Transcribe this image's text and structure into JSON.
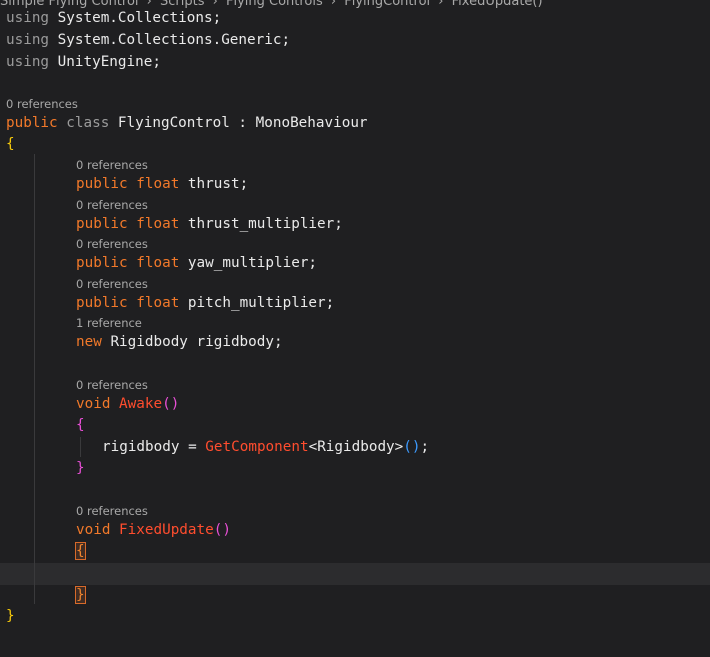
{
  "breadcrumb": {
    "items": [
      "Simple Flying Control",
      "Scripts",
      "Flying Controls",
      "FlyingControl",
      "FixedUpdate()"
    ],
    "separator": "›"
  },
  "code": {
    "using1_kw": "using",
    "using1_ns": "System.Collections;",
    "using2_kw": "using",
    "using2_ns": "System.Collections.Generic;",
    "using3_kw": "using",
    "using3_ns": "UnityEngine;",
    "class_refs": "0 references",
    "class_public": "public",
    "class_kw": "class",
    "class_name": "FlyingControl : MonoBehaviour",
    "class_open": "{",
    "fields": [
      {
        "refs": "0 references",
        "mod": "public",
        "type": "float",
        "name": "thrust;"
      },
      {
        "refs": "0 references",
        "mod": "public",
        "type": "float",
        "name": "thrust_multiplier;"
      },
      {
        "refs": "0 references",
        "mod": "public",
        "type": "float",
        "name": "yaw_multiplier;"
      },
      {
        "refs": "0 references",
        "mod": "public",
        "type": "float",
        "name": "pitch_multiplier;"
      }
    ],
    "rb_refs": "1 reference",
    "rb_new": "new",
    "rb_decl": "Rigidbody rigidbody;",
    "awake_refs": "0 references",
    "awake_void": "void",
    "awake_name": "Awake",
    "awake_parens": "()",
    "awake_open": "{",
    "awake_body_a": "rigidbody = ",
    "awake_body_method": "GetComponent",
    "awake_body_b": "<Rigidbody>",
    "awake_body_parens": "()",
    "awake_body_semi": ";",
    "awake_close": "}",
    "fixed_refs": "0 references",
    "fixed_void": "void",
    "fixed_name": "FixedUpdate",
    "fixed_parens": "()",
    "fixed_open": "{",
    "fixed_close": "}",
    "class_close": "}"
  }
}
